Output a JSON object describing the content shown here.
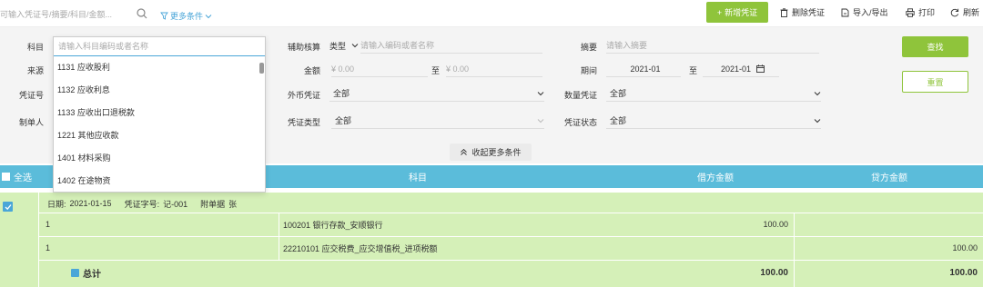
{
  "toolbar": {
    "search_placeholder": "可输入凭证号/摘要/科目/金额...",
    "more_conditions": "更多条件",
    "new_voucher": "新增凭证",
    "delete_voucher": "删除凭证",
    "import_export": "导入/导出",
    "print": "打印",
    "refresh": "刷新"
  },
  "filter": {
    "subject_label": "科目",
    "subject_placeholder": "请输入科目编码或者名称",
    "source_label": "来源",
    "voucher_no_label": "凭证号",
    "maker_label": "制单人",
    "aux_label": "辅助核算",
    "aux_type": "类型",
    "aux_placeholder": "请输入编码或者名称",
    "amount_label": "金额",
    "amount_from_placeholder": "¥ 0.00",
    "amount_to": "至",
    "amount_to_placeholder": "¥ 0.00",
    "fx_label": "外币凭证",
    "fx_value": "全部",
    "type_label": "凭证类型",
    "type_value": "全部",
    "summary_label": "摘要",
    "summary_placeholder": "请输入摘要",
    "period_label": "期间",
    "period_from": "2021-01",
    "period_to_label": "至",
    "period_to": "2021-01",
    "qty_label": "数量凭证",
    "qty_value": "全部",
    "status_label": "凭证状态",
    "status_value": "全部",
    "search_button": "查找",
    "reset_button": "重置",
    "collapse_button": "收起更多条件"
  },
  "dropdown": {
    "items": [
      "1131 应收股利",
      "1132 应收利息",
      "1133 应收出口退税款",
      "1221 其他应收款",
      "1401 材料采购",
      "1402 在途物资"
    ]
  },
  "table": {
    "select_all": "全选",
    "col_subject": "科目",
    "col_debit": "借方金额",
    "col_credit": "贷方金额"
  },
  "voucher": {
    "date_label": "日期:",
    "date": "2021-01-15",
    "word_label": "凭证字号:",
    "word": "记-001",
    "attach_label": "附单据",
    "attach_unit": "张",
    "rows": [
      {
        "summary": "1",
        "subject": "100201 银行存款_安顺银行",
        "debit": "100.00",
        "credit": ""
      },
      {
        "summary": "1",
        "subject": "22210101 应交税费_应交增值税_进项税额",
        "debit": "",
        "credit": "100.00"
      }
    ],
    "total_label": "总计",
    "total_debit": "100.00",
    "total_credit": "100.00"
  },
  "colors": {
    "accent": "#8fc43b",
    "header": "#5bbcda",
    "row_bg": "#d5f0b8",
    "link": "#4aa6d8"
  }
}
